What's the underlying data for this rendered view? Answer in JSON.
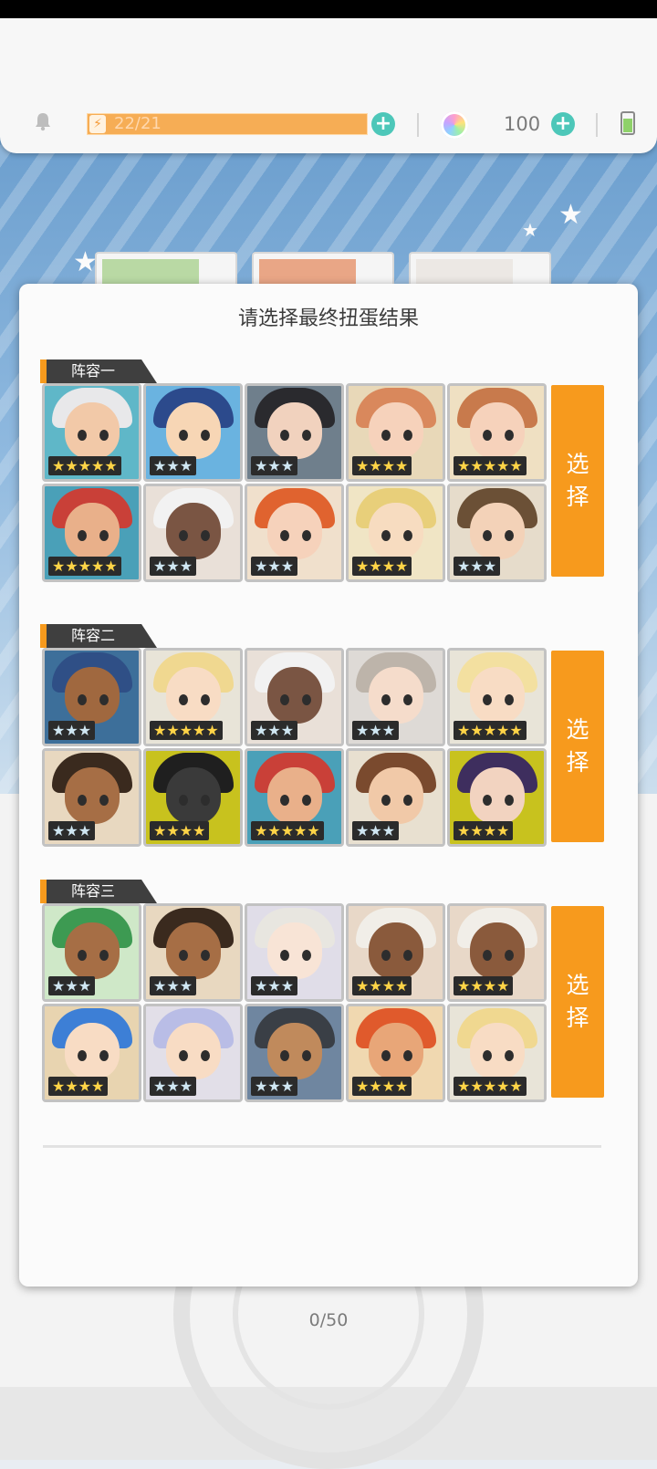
{
  "topbar": {
    "energy_text": "22/21",
    "gem_count": "100"
  },
  "dialog": {
    "title": "请选择最终扭蛋结果",
    "select_label_line1": "选",
    "select_label_line2": "择"
  },
  "teams": [
    {
      "name": "阵容一",
      "heroes": [
        {
          "stars": 5,
          "face": "#f2c9a8",
          "hair": "#e8e8ea",
          "bg": "#5fb7c8"
        },
        {
          "stars": 3,
          "face": "#f7d6b5",
          "hair": "#2c4a8c",
          "bg": "#6ab3e0"
        },
        {
          "stars": 3,
          "face": "#f1d2be",
          "hair": "#2a2a2e",
          "bg": "#6f7f8c"
        },
        {
          "stars": 4,
          "face": "#f6d2bb",
          "hair": "#d9885c",
          "bg": "#e8d8b8"
        },
        {
          "stars": 5,
          "face": "#f6d2bb",
          "hair": "#c87a4c",
          "bg": "#efe0c2"
        },
        {
          "stars": 5,
          "face": "#e9b08a",
          "hair": "#c94038",
          "bg": "#4aa0b8"
        },
        {
          "stars": 3,
          "face": "#7a5543",
          "hair": "#f2f2f2",
          "bg": "#e9e0d8"
        },
        {
          "stars": 3,
          "face": "#f6d2bb",
          "hair": "#e0632f",
          "bg": "#f0e0cc"
        },
        {
          "stars": 4,
          "face": "#f7dcc0",
          "hair": "#e8cf7a",
          "bg": "#f0e5c5"
        },
        {
          "stars": 3,
          "face": "#f3d2b8",
          "hair": "#6b5036",
          "bg": "#e6dccb"
        }
      ]
    },
    {
      "name": "阵容二",
      "heroes": [
        {
          "stars": 3,
          "face": "#a0683f",
          "hair": "#2f4f86",
          "bg": "#3d6f9a"
        },
        {
          "stars": 5,
          "face": "#f8dcc4",
          "hair": "#f0d890",
          "bg": "#e8e4d8"
        },
        {
          "stars": 3,
          "face": "#7a5543",
          "hair": "#f2f2f2",
          "bg": "#e9e0d8"
        },
        {
          "stars": 3,
          "face": "#f5dccb",
          "hair": "#bdb4aa",
          "bg": "#dedad6"
        },
        {
          "stars": 5,
          "face": "#f8dcc4",
          "hair": "#f3e0a0",
          "bg": "#e8e4d8"
        },
        {
          "stars": 3,
          "face": "#a66e45",
          "hair": "#3a2a1e",
          "bg": "#e8d8c0"
        },
        {
          "stars": 4,
          "face": "#3a3a3a",
          "hair": "#1f1f1f",
          "bg": "#c8c21e"
        },
        {
          "stars": 5,
          "face": "#e9b08a",
          "hair": "#c94038",
          "bg": "#4aa0b8"
        },
        {
          "stars": 3,
          "face": "#f1c9a8",
          "hair": "#7a4a2e",
          "bg": "#e8e0d0"
        },
        {
          "stars": 4,
          "face": "#f2d3c0",
          "hair": "#3e2e5e",
          "bg": "#c8c21e"
        }
      ]
    },
    {
      "name": "阵容三",
      "heroes": [
        {
          "stars": 3,
          "face": "#a66e45",
          "hair": "#3d9a52",
          "bg": "#cfe8c8"
        },
        {
          "stars": 3,
          "face": "#a66e45",
          "hair": "#3a2a1e",
          "bg": "#e8d8c0"
        },
        {
          "stars": 3,
          "face": "#f8e4d6",
          "hair": "#e8e6e0",
          "bg": "#e0dde8"
        },
        {
          "stars": 4,
          "face": "#8a5a3c",
          "hair": "#f1eee8",
          "bg": "#e8d8c8"
        },
        {
          "stars": 4,
          "face": "#8a5a3c",
          "hair": "#f1eee8",
          "bg": "#e8d8c8"
        },
        {
          "stars": 4,
          "face": "#f8dcc4",
          "hair": "#3d7fd6",
          "bg": "#e8d4b0"
        },
        {
          "stars": 3,
          "face": "#f8dcc4",
          "hair": "#b9bde6",
          "bg": "#e2dfe8"
        },
        {
          "stars": 3,
          "face": "#c08a5c",
          "hair": "#3a3f46",
          "bg": "#6f86a0"
        },
        {
          "stars": 4,
          "face": "#e8a678",
          "hair": "#e05a2c",
          "bg": "#f0d8b0"
        },
        {
          "stars": 5,
          "face": "#f8dcc4",
          "hair": "#f0d890",
          "bg": "#e8e4d8"
        }
      ]
    }
  ],
  "bottom": {
    "pull_counter": "0/50"
  },
  "colors": {
    "accent_orange": "#f79a1d",
    "teal_plus": "#4dc7b9",
    "star_gold": "#ffd447",
    "star_silver": "#cfe6f2"
  }
}
